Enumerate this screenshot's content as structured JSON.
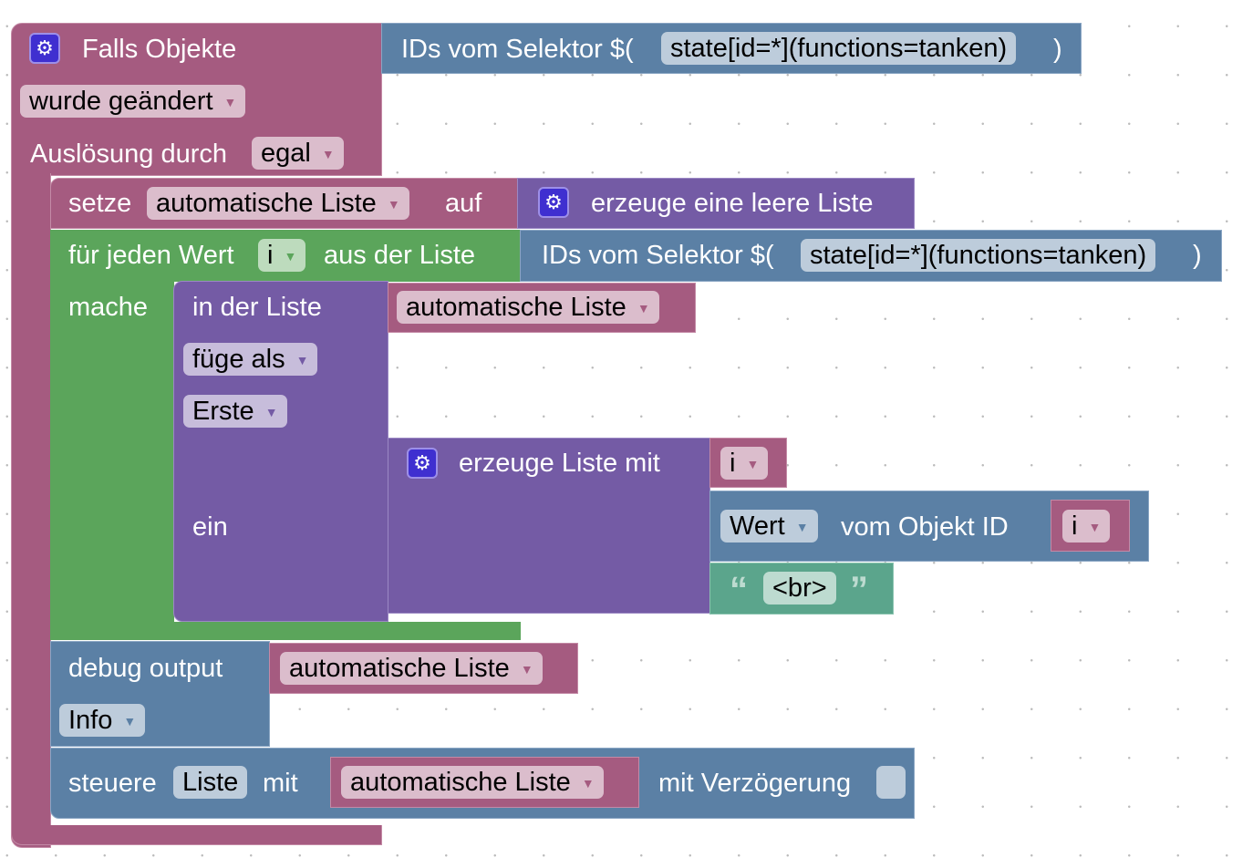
{
  "trigger": {
    "title": "Falls Objekte",
    "event": "wurde geändert",
    "cause_label": "Auslösung durch",
    "cause": "egal"
  },
  "selector1": {
    "label": "IDs vom Selektor $(",
    "value": "state[id=*](functions=tanken)",
    "close": ")"
  },
  "set": {
    "label": "setze",
    "var": "automatische Liste",
    "to": "auf",
    "create_empty": "erzeuge eine leere Liste"
  },
  "foreach": {
    "label": "für jeden Wert",
    "var": "i",
    "from": "aus der Liste",
    "do": "mache"
  },
  "selector2": {
    "label": "IDs vom Selektor $(",
    "value": "state[id=*](functions=tanken)",
    "close": ")"
  },
  "insert": {
    "in_list": "in der Liste",
    "list_var": "automatische Liste",
    "mode": "füge als",
    "position": "Erste",
    "in": "ein"
  },
  "create_with": {
    "label": "erzeuge Liste mit",
    "item1": "i",
    "value_prop": "Wert",
    "value_of": "vom Objekt ID",
    "value_id": "i",
    "text": "<br>",
    "quote_open": "“",
    "quote_close": "”"
  },
  "debug": {
    "label": "debug output",
    "var": "automatische Liste",
    "level": "Info"
  },
  "control": {
    "label": "steuere",
    "target": "Liste",
    "with": "mit",
    "var": "automatische Liste",
    "delay_label": "mit Verzögerung"
  },
  "colors": {
    "event": "#a55b80",
    "logic": "#5b80a5",
    "loop": "#5ba55b",
    "list": "#745ba5",
    "text": "#5ba58c"
  }
}
